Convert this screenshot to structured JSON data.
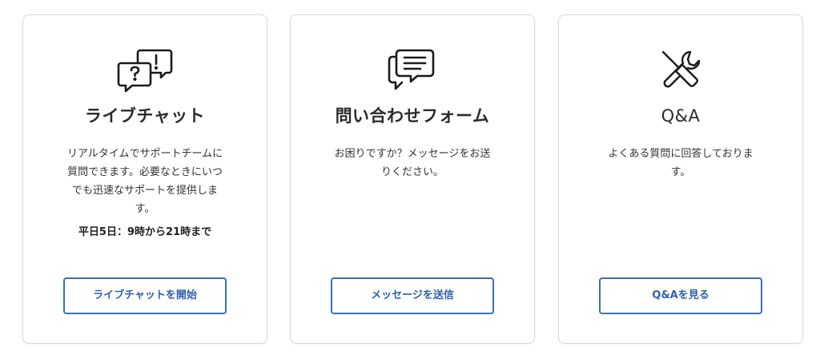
{
  "cards": [
    {
      "icon": "question-exclamation-chat-icon",
      "title": "ライブチャット",
      "description": "リアルタイムでサポートチームに質問できます。必要なときにいつでも迅速なサポートを提供します。",
      "hours": "平日5日：9時から21時まで",
      "button_label": "ライブチャットを開始"
    },
    {
      "icon": "message-form-icon",
      "title": "問い合わせフォーム",
      "description": "お困りですか？メッセージをお送りください。",
      "button_label": "メッセージを送信"
    },
    {
      "icon": "tools-icon",
      "title": "Q&A",
      "description": "よくある質問に回答しております。",
      "button_label": "Q&Aを見る"
    }
  ],
  "colors": {
    "accent": "#3b6fb6",
    "border": "#d7dade",
    "text": "#2b2b2b"
  }
}
